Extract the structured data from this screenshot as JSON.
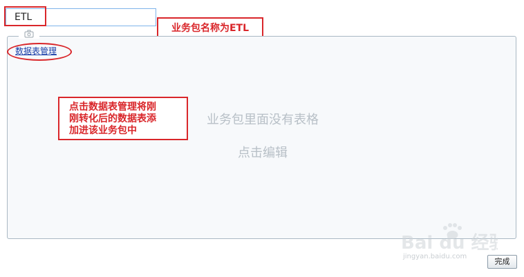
{
  "package": {
    "name_value": "ETL",
    "name_callout": "业务包名称为ETL"
  },
  "panel": {
    "table_mgmt_link": "数据表管理",
    "empty_message": "业务包里面没有表格",
    "edit_hint": "点击编辑",
    "tab_icon": "camera-icon"
  },
  "instruction_callout": {
    "line1": "点击数据表管理将刚",
    "line2": "刚转化后的数据表添",
    "line3": "加进该业务包中"
  },
  "footer": {
    "done_label": "完成"
  },
  "watermark": {
    "logo_text": "Bai du 经验",
    "url_text": "jingyan.baidu.com"
  },
  "colors": {
    "annotation_red": "#d9262a",
    "link_blue": "#1a3fa8",
    "panel_bg": "#f7f9fb",
    "placeholder_gray": "#b8c0c7"
  }
}
